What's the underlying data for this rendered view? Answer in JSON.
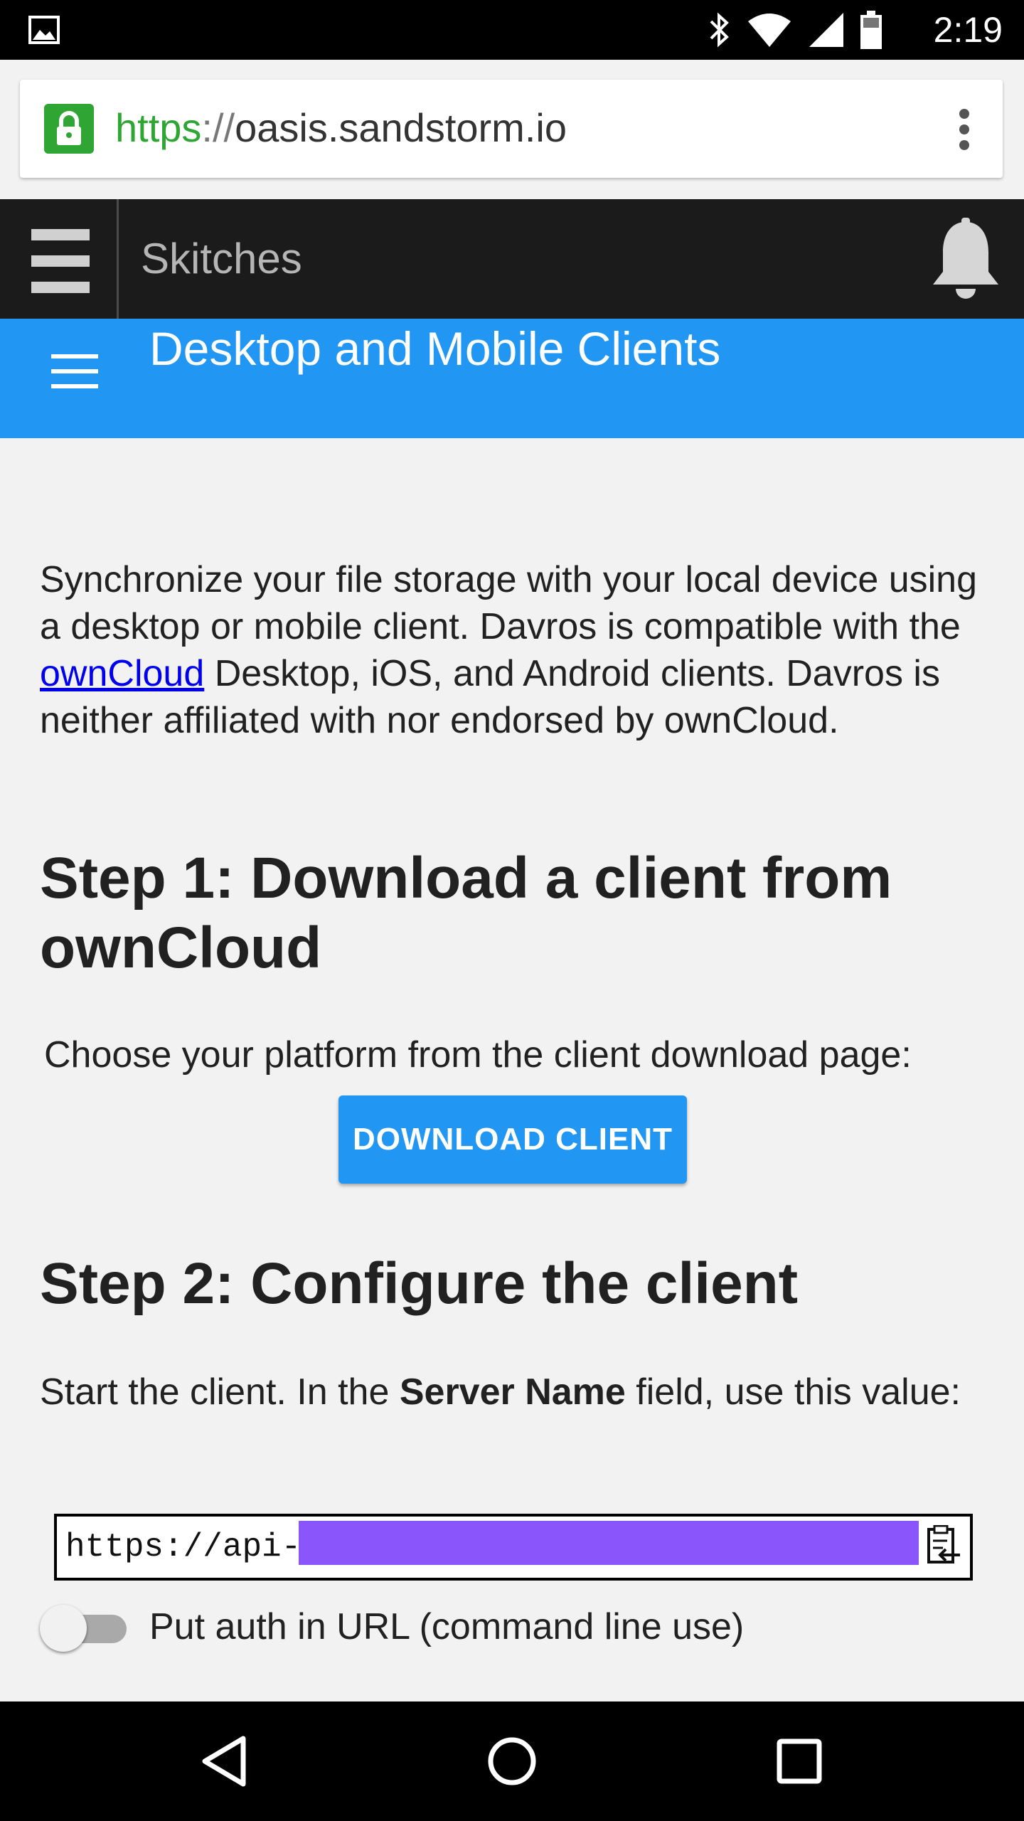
{
  "status_bar": {
    "time": "2:19",
    "icons": [
      "gallery-icon",
      "bluetooth-icon",
      "wifi-icon",
      "signal-icon",
      "battery-icon"
    ]
  },
  "browser": {
    "url_scheme": "https",
    "url_separator": "://",
    "url_host": "oasis.sandstorm.io",
    "secure": true
  },
  "app_toolbar": {
    "title": "Skitches"
  },
  "header": {
    "title": "Desktop and Mobile Clients"
  },
  "content": {
    "intro_part1": "Synchronize your file storage with your local device using a desktop or mobile client. Davros is compatible with the ",
    "intro_link": "ownCloud",
    "intro_part2": " Desktop, iOS, and Android clients. Davros is neither affiliated with nor endorsed by ownCloud.",
    "step1_heading": "Step 1: Download a client from ownCloud",
    "choose_text": "Choose your platform from the client download page:",
    "download_button": "DOWNLOAD CLIENT",
    "step2_heading": "Step 2: Configure the client",
    "start_part1": "Start the client. In the ",
    "start_bold": "Server Name",
    "start_part2": " field, use this value:",
    "server_value": "https://api-",
    "toggle_label": "Put auth in URL (command line use)",
    "toggle_on": false
  },
  "colors": {
    "accent": "#2196f3",
    "secure_green": "#2fa534",
    "redaction": "#8a55fb",
    "link": "#0000ee"
  }
}
